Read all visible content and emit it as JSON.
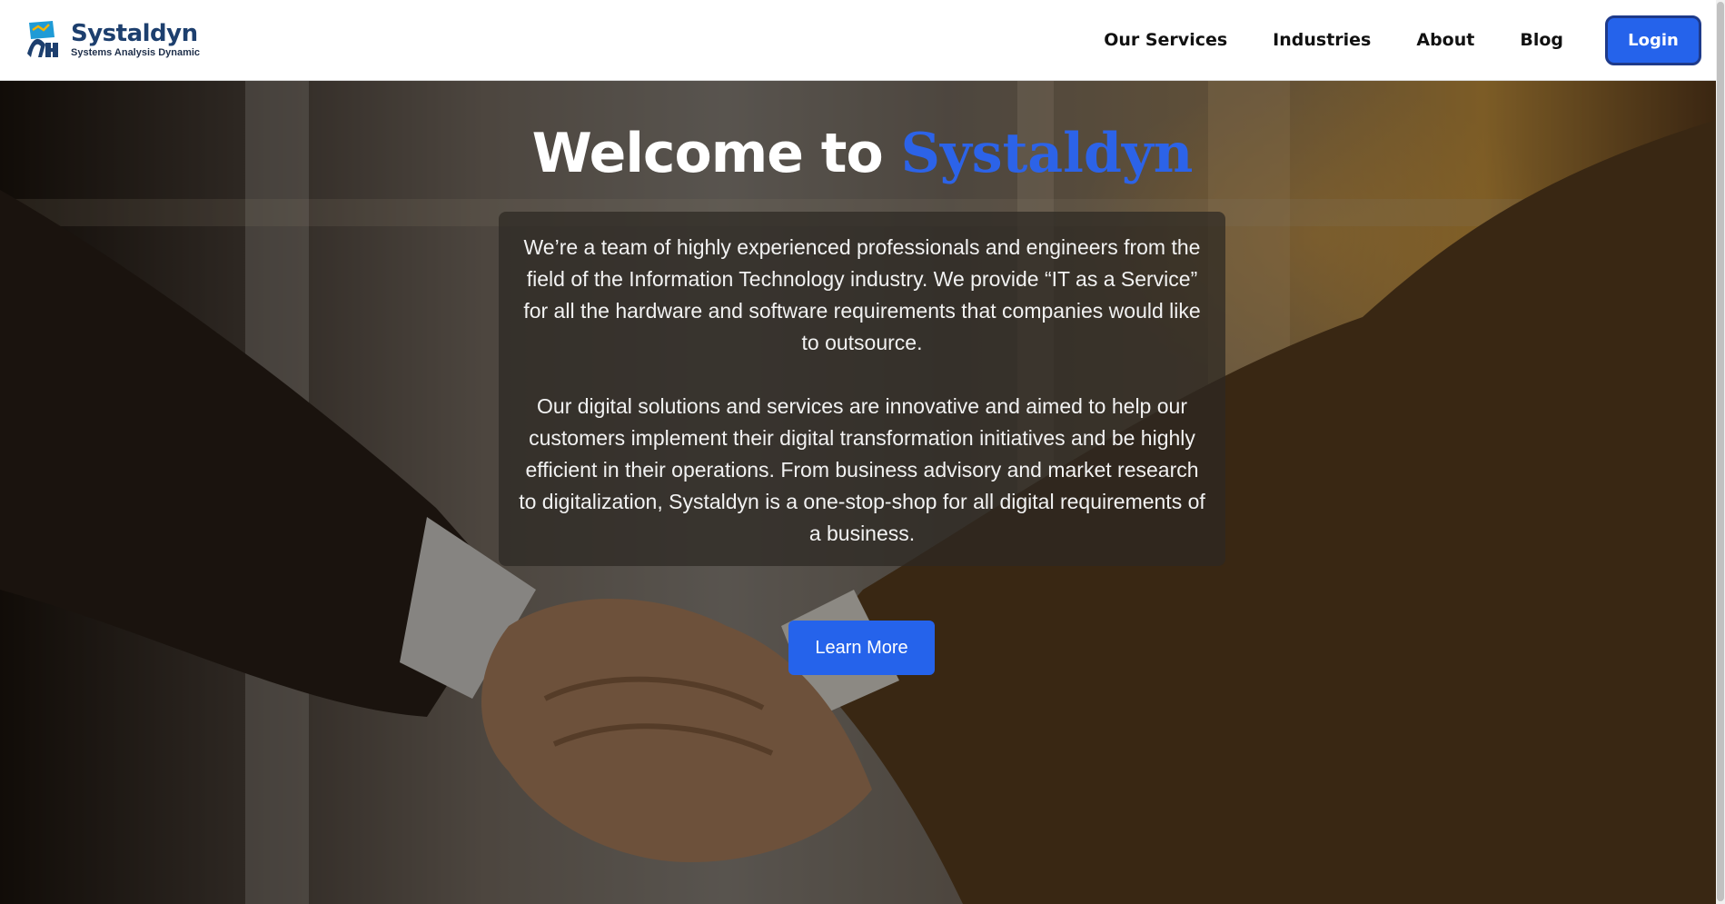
{
  "brand": {
    "name": "Systaldyn",
    "tagline": "Systems Analysis Dynamic",
    "logo_icon": "systaldyn-logo-icon"
  },
  "nav": {
    "links": [
      {
        "label": "Our Services"
      },
      {
        "label": "Industries"
      },
      {
        "label": "About"
      },
      {
        "label": "Blog"
      }
    ],
    "login_label": "Login"
  },
  "hero": {
    "title_prefix": "Welcome to",
    "title_brand": "Systaldyn",
    "paragraphs": [
      "We’re a team of highly experienced professionals and engineers from the field of the Information Technology industry. We provide “IT as a Service” for all the hardware and software requirements that companies would like to outsource.",
      "Our digital solutions and services are innovative and aimed to help our customers implement their digital transformation initiatives and be highly efficient in their operations. From business advisory and market research to digitalization, Systaldyn is a one-stop-shop for all digital requirements of a business."
    ],
    "cta_label": "Learn More",
    "background_image": "handshake-photo"
  },
  "colors": {
    "accent": "#2563eb",
    "brand_dark": "#1d3f6e"
  }
}
